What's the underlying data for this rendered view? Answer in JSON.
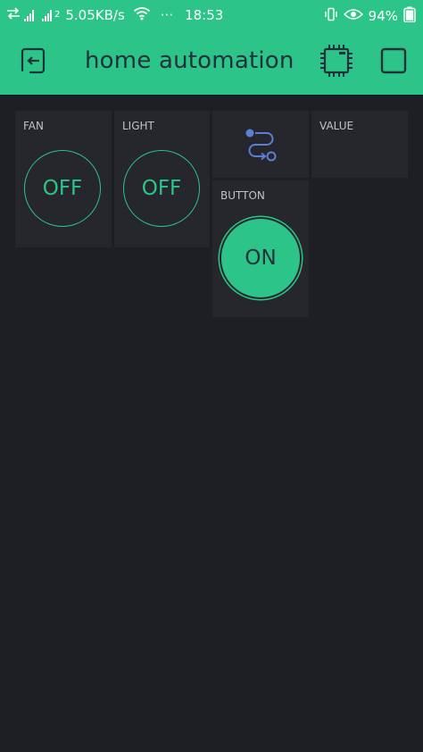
{
  "status_bar": {
    "speed": "5.05KB/s",
    "sim_label": "2",
    "dots": "···",
    "time": "18:53",
    "battery": "94%"
  },
  "app_bar": {
    "title": "home automation"
  },
  "widgets": {
    "fan": {
      "label": "FAN",
      "state": "OFF"
    },
    "light": {
      "label": "LIGHT",
      "state": "OFF"
    },
    "value": {
      "label": "VALUE"
    },
    "button": {
      "label": "BUTTON",
      "state": "ON"
    }
  },
  "colors": {
    "accent": "#2cc489",
    "background": "#1d1f24",
    "widget": "#25272c",
    "eventor_icon": "#5b7fd6"
  },
  "icons": {
    "back": "exit-icon",
    "device": "chip-icon",
    "square": "square-icon",
    "eventor": "eventor-icon"
  }
}
